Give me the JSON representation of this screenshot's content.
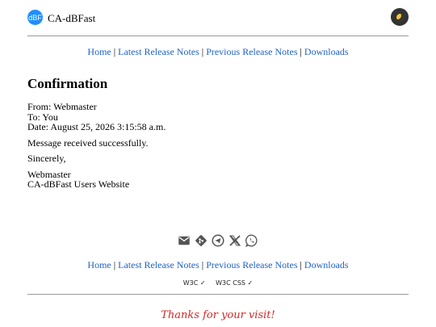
{
  "header": {
    "logo_text": "dBF",
    "site_title": "CA-dBFast"
  },
  "nav": {
    "home": "Home",
    "latest": "Latest Release Notes",
    "previous": "Previous Release Notes",
    "downloads": "Downloads",
    "sep": "|"
  },
  "message": {
    "title": "Confirmation",
    "from": "From: Webmaster",
    "to": "To: You",
    "date": "Date: August 25, 2026 3:15:58 a.m.",
    "body": "Message received successfully.",
    "closing": "Sincerely,",
    "signature_name": "Webmaster",
    "signature_site": "CA-dBFast Users Website"
  },
  "social": [
    "email-icon",
    "git-icon",
    "telegram-icon",
    "x-icon",
    "whatsapp-icon"
  ],
  "badges": {
    "w3c": "W3C ✓",
    "w3c_css": "W3C CSS ✓"
  },
  "footer": {
    "thanks": "Thanks for your visit!"
  },
  "colors": {
    "link": "#1e62c8",
    "thanks": "#d42626",
    "logo": "#1e90ff"
  }
}
